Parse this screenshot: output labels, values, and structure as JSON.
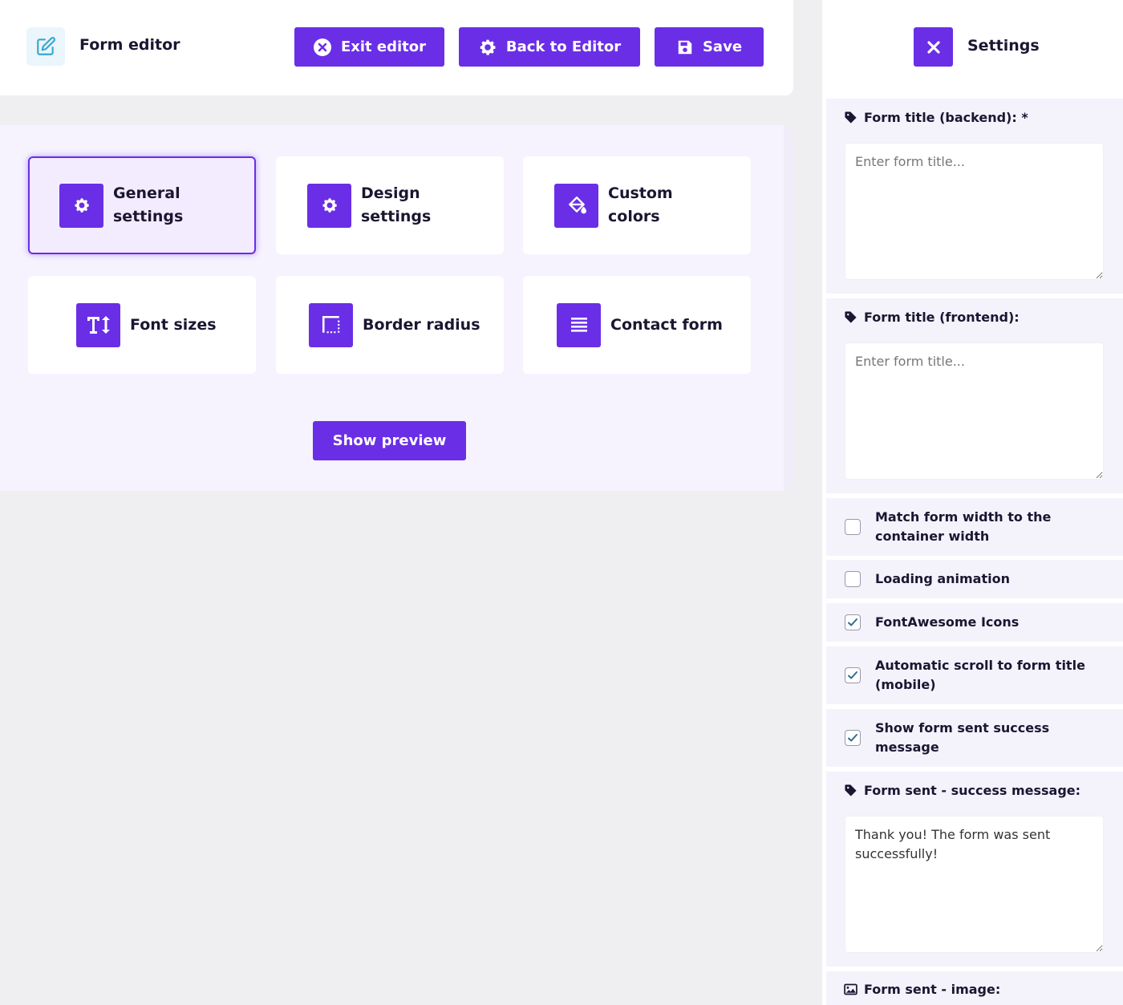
{
  "header": {
    "title": "Form editor",
    "buttons": {
      "exit": "Exit editor",
      "back": "Back to Editor",
      "save": "Save"
    }
  },
  "main": {
    "cards": [
      {
        "label_line1": "General",
        "label_line2": "settings",
        "icon": "gear-icon",
        "active": true
      },
      {
        "label_line1": "Design",
        "label_line2": "settings",
        "icon": "gear-icon",
        "active": false
      },
      {
        "label_line1": "Custom",
        "label_line2": "colors",
        "icon": "paint-bucket-icon",
        "active": false
      },
      {
        "label": "Font sizes",
        "icon": "text-height-icon",
        "active": false
      },
      {
        "label": "Border radius",
        "icon": "border-radius-icon",
        "active": false
      },
      {
        "label": "Contact form",
        "icon": "align-justify-icon",
        "active": false
      }
    ],
    "preview_button": "Show preview"
  },
  "settings": {
    "title": "Settings",
    "form_title_backend": {
      "label": "Form title (backend): *",
      "placeholder": "Enter form title..."
    },
    "form_title_frontend": {
      "label": "Form title (frontend):",
      "placeholder": "Enter form title..."
    },
    "checkboxes": [
      {
        "label": "Match form width to the container width",
        "checked": false
      },
      {
        "label": "Loading animation",
        "checked": false
      },
      {
        "label": "FontAwesome Icons",
        "checked": true
      },
      {
        "label": "Automatic scroll to form title (mobile)",
        "checked": true
      },
      {
        "label": "Show form sent success message",
        "checked": true
      }
    ],
    "success_message": {
      "label": "Form sent - success message:",
      "value": "Thank you! The form was sent successfully!"
    },
    "sent_image": {
      "label": "Form sent - image:"
    }
  },
  "colors": {
    "accent": "#6a2ee6",
    "panel_bg": "#f6f3fe",
    "page_bg": "#efeef1"
  }
}
